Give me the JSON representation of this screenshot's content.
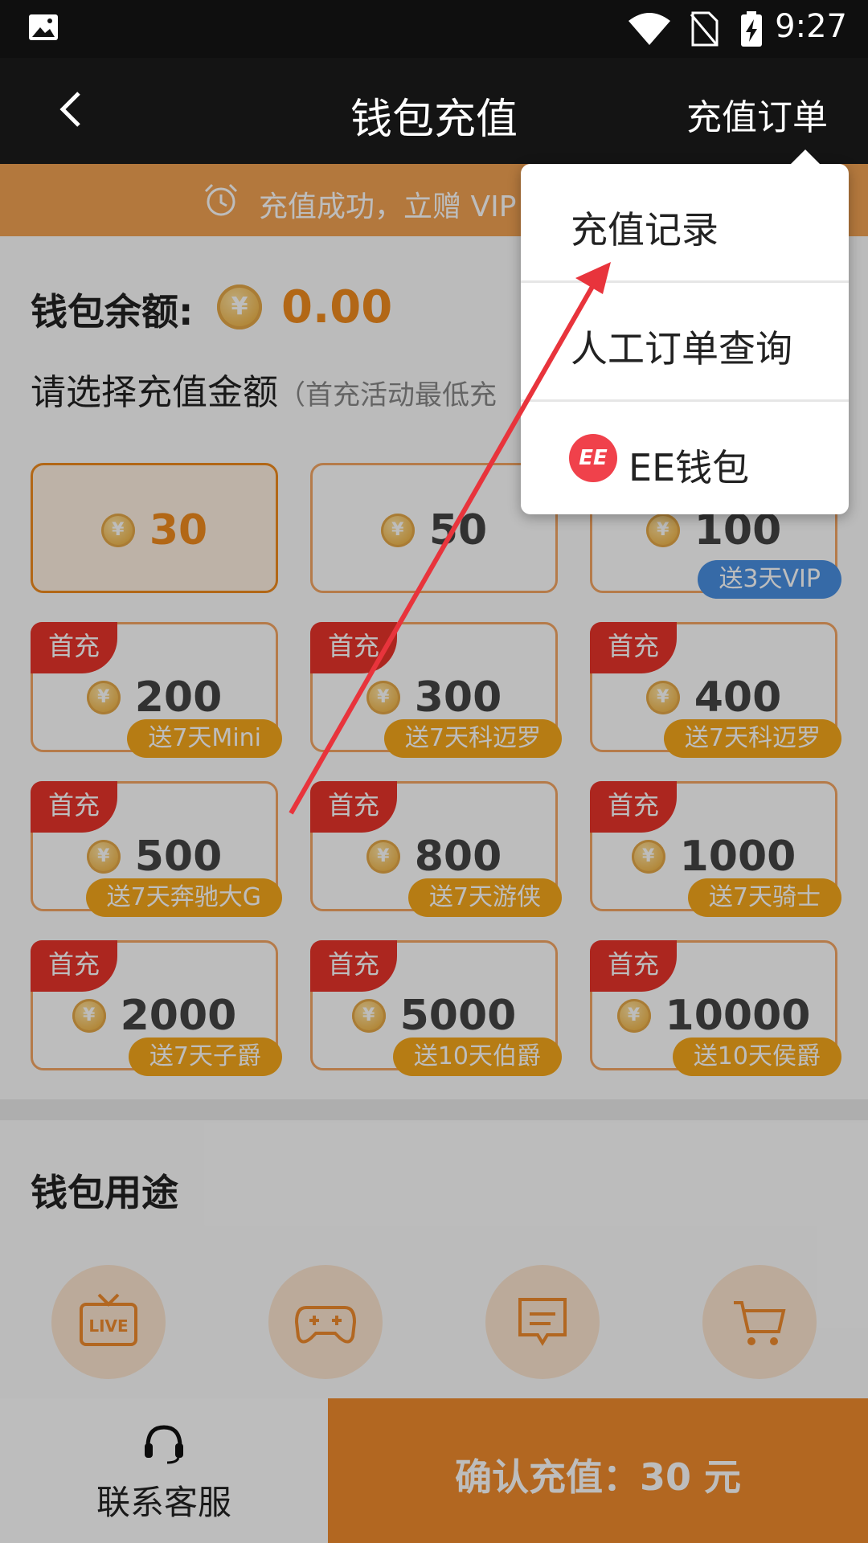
{
  "status_bar": {
    "time": "9:27"
  },
  "header": {
    "title": "钱包充值",
    "right_action": "充值订单"
  },
  "banner": {
    "text": "充值成功，立赠 VIP"
  },
  "wallet": {
    "balance_label": "钱包余额:",
    "balance_value": "0.00",
    "coin_symbol": "¥"
  },
  "select_amount": {
    "label": "请选择充值金额",
    "hint": "（首充活动最低充"
  },
  "options": [
    {
      "amount": "30",
      "selected": true,
      "first_charge": false,
      "gift": ""
    },
    {
      "amount": "50",
      "selected": false,
      "first_charge": false,
      "gift": ""
    },
    {
      "amount": "100",
      "selected": false,
      "first_charge": false,
      "gift": "送3天VIP",
      "gift_style": "blue"
    },
    {
      "amount": "200",
      "selected": false,
      "first_charge": true,
      "gift": "送7天Mini"
    },
    {
      "amount": "300",
      "selected": false,
      "first_charge": true,
      "gift": "送7天科迈罗"
    },
    {
      "amount": "400",
      "selected": false,
      "first_charge": true,
      "gift": "送7天科迈罗"
    },
    {
      "amount": "500",
      "selected": false,
      "first_charge": true,
      "gift": "送7天奔驰大G"
    },
    {
      "amount": "800",
      "selected": false,
      "first_charge": true,
      "gift": "送7天游侠"
    },
    {
      "amount": "1000",
      "selected": false,
      "first_charge": true,
      "gift": "送7天骑士"
    },
    {
      "amount": "2000",
      "selected": false,
      "first_charge": true,
      "gift": "送7天子爵"
    },
    {
      "amount": "5000",
      "selected": false,
      "first_charge": true,
      "gift": "送10天伯爵"
    },
    {
      "amount": "10000",
      "selected": false,
      "first_charge": true,
      "gift": "送10天侯爵"
    }
  ],
  "first_charge_tag": "首充",
  "usage": {
    "title": "钱包用途",
    "icons": [
      "live-icon",
      "gamepad-icon",
      "message-icon",
      "cart-icon"
    ]
  },
  "bottom": {
    "service_label": "联系客服",
    "confirm_label": "确认充值：30 元"
  },
  "popup_menu": {
    "items": [
      "充值记录",
      "人工订单查询",
      "EE钱包"
    ],
    "ee_logo": "EE"
  },
  "colors": {
    "accent": "#f08b2d",
    "first_charge_red": "#e8342a",
    "gift_gold": "#f6a81c",
    "gift_blue": "#4a90e2",
    "annotation_arrow": "#e8343c"
  }
}
